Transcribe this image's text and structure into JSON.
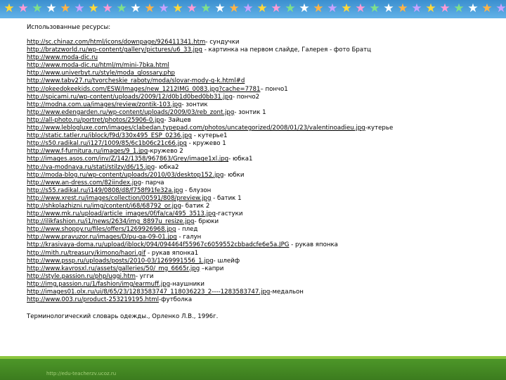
{
  "heading": "Использованные ресурсы:",
  "resources": [
    {
      "link": " http://sc.chinaz.com/html/icons/downpage/926411341.htm",
      "note": "- сундучки"
    },
    {
      "link": "http://bratzworld.ru/wp-content/gallery/pictures/u6_33.jpg",
      "note": " - картинка на первом слайде, Галерея - фото Братц"
    },
    {
      "link": "http://www.moda-dic.ru",
      "note": ""
    },
    {
      "link": "http://www.moda-dic.ru/html/m/mini-7bka.html",
      "note": ""
    },
    {
      "link": "http://www.univerbyt.ru/style/moda_glossary.php",
      "note": ""
    },
    {
      "link": "http://www.tabv27.ru/tvorcheskie_raboty/moda/slovar-mody-g-k.html#d",
      "note": ""
    },
    {
      "link": "http://okeedokeekids.com/ESW/Images/new_1212IMG_0083.jpg?cache=7781",
      "note": "– пончо1"
    },
    {
      "link": "http://spicami.ru/wp-content/uploads/2009/12/d0b1d0bed0bb31.jpg",
      "note": "- пончо2"
    },
    {
      "link": "http://modna.com.ua/images/review/zontik-103.jpg",
      "note": "- зонтик"
    },
    {
      "link": "http://www.edengarden.ru/wp-content/uploads/2009/03/reb_zont.jpg",
      "note": "- зонтик 1"
    },
    {
      "link": "http://all-photo.ru/portret/photos/25906-0.jpg",
      "note": "- Зайцев"
    },
    {
      "link": "http://www.leblogluxe.com/images/clabedan.typepad.com/photos/uncategorized/2008/01/23/valentinoadieu.jpg",
      "note": "-кутерье",
      "wrap": true
    },
    {
      "link": "http://static.tatler.ru/iblock/f9d/330x495_ESP_0236.jpg",
      "note": " - кутерье1"
    },
    {
      "link": "http://s50.radikal.ru/i127/1009/85/6c1b06c21c66.jpg",
      "note": " - кружево 1"
    },
    {
      "link": "http://www.f-furnitura.ru/images/9_1.jpg",
      "note": "-кружево 2"
    },
    {
      "link": "http://images.asos.com/inv/Z/142/1358/967863/Grey/image1xl.jpg",
      "note": "- юбка1"
    },
    {
      "link": "http://va-modnaya.ru/stati/stilzy/d6/15.jpg",
      "note": "- юбка2"
    },
    {
      "link": "http://moda-blog.ru/wp-content/uploads/2010/03/desktop152.jpg",
      "note": "- юбки"
    },
    {
      "link": "http://www.an-dress.com/82iindex.jpg",
      "note": "- парча"
    },
    {
      "link": "http://s55.radikal.ru/i149/0808/d8/f758f91fe32a.jpg",
      "note": " - блузон"
    },
    {
      "link": "http://www.xrest.ru/images/collection/00591/808/preview.jpg",
      "note": " - батик 1"
    },
    {
      "link": "http://shkolazhizni.ru/img/content/i68/68792_or.jpg",
      "note": "- батик 2"
    },
    {
      "link": "http://www.mk.ru/upload/article_images/0f/fa/ca/495_3513.jpg",
      "note": "-гастуки"
    },
    {
      "link": "http://ilikfashion.ru/i1/news/2634/img_8897u_resize.jpg",
      "note": "- брюки"
    },
    {
      "link": "http://www.shoppy.ru/files/offers/1269926968.jpg",
      "note": " - плед"
    },
    {
      "link": "http://www.pravuzor.ru/images/D/pu-ga-09-01.jpg",
      "note": " - галун"
    },
    {
      "link": "http://krasivaya-doma.ru/upload/iblock/094/094464f55967c6059552cbbadcfe6e5a.JPG",
      "note": "   - рукав японка"
    },
    {
      "link": "http://mith.ru/treasury/kimono/haori.gif",
      "note": " - рукав японка1"
    },
    {
      "link": "http://www.pssp.ru/uploads/posts/2010-03/1269991556_1.jpg",
      "note": "- шлейф"
    },
    {
      "link": "http://www.kavrosxl.ru/assets/galleries/50/_mg_6665r.jpg",
      "note": " –капри"
    },
    {
      "link": "http://style.passion.ru/php/uggi.htm",
      "note": "- угги"
    },
    {
      "link": "http://img.passion.ru/1/fashion/img/earmuff.jpg",
      "note": "-наушники"
    },
    {
      "link": "http://images01.olx.ru/ui/8/65/23/1283583747_118036223_2----1283583747.jpg",
      "note": "-медальон"
    },
    {
      "link": "http://www.003.ru/product-253219195.html",
      "note": "-футболка"
    }
  ],
  "footer": "Терминологический словарь одежды., Орленко Л.В., 1996г.",
  "watermark": "http://edu-teacherzv.ucoz.ru",
  "colors": {
    "top_border": "#3b8fcf",
    "bottom_bar": "#4f9a2a",
    "stars": [
      "#ffd83a",
      "#ff9ad5",
      "#7fe08a",
      "#ffffff",
      "#ffb347",
      "#c8a2ff"
    ]
  }
}
